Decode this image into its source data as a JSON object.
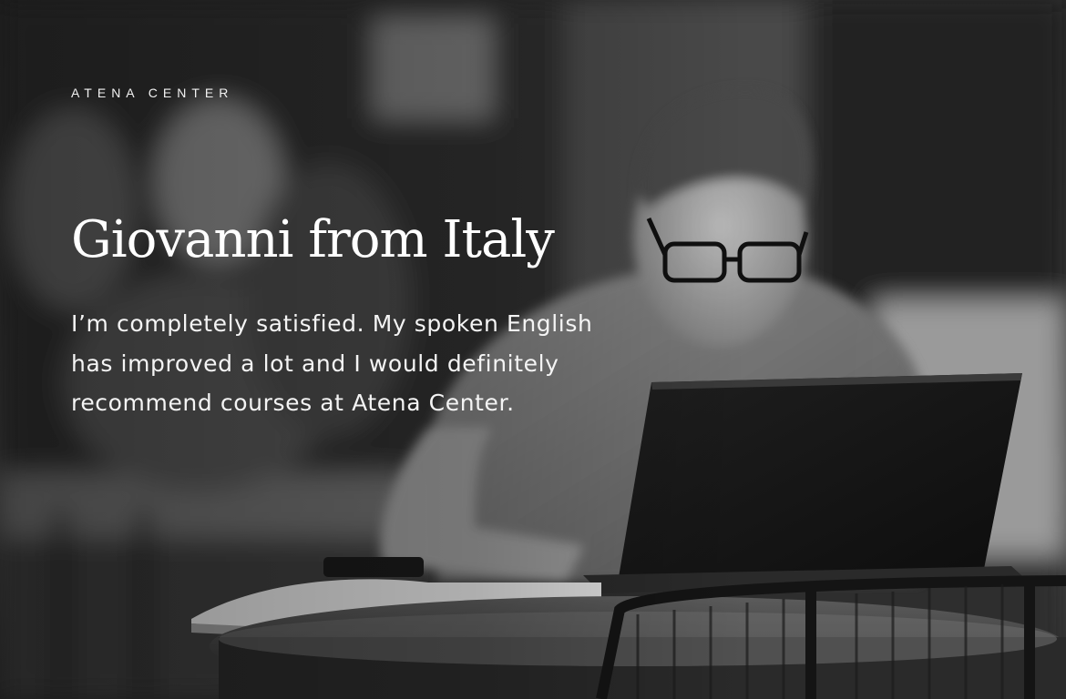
{
  "brand": "ATENA CENTER",
  "testimonial": {
    "title": "Giovanni from Italy",
    "quote": "I’m completely satisfied. My spoken English has improved a lot and I would definitely recommend courses at Atena Center."
  },
  "photo": {
    "palette": {
      "dark": "#1a1a1a",
      "mid": "#6b6b6b",
      "light": "#d9d9d9"
    }
  }
}
